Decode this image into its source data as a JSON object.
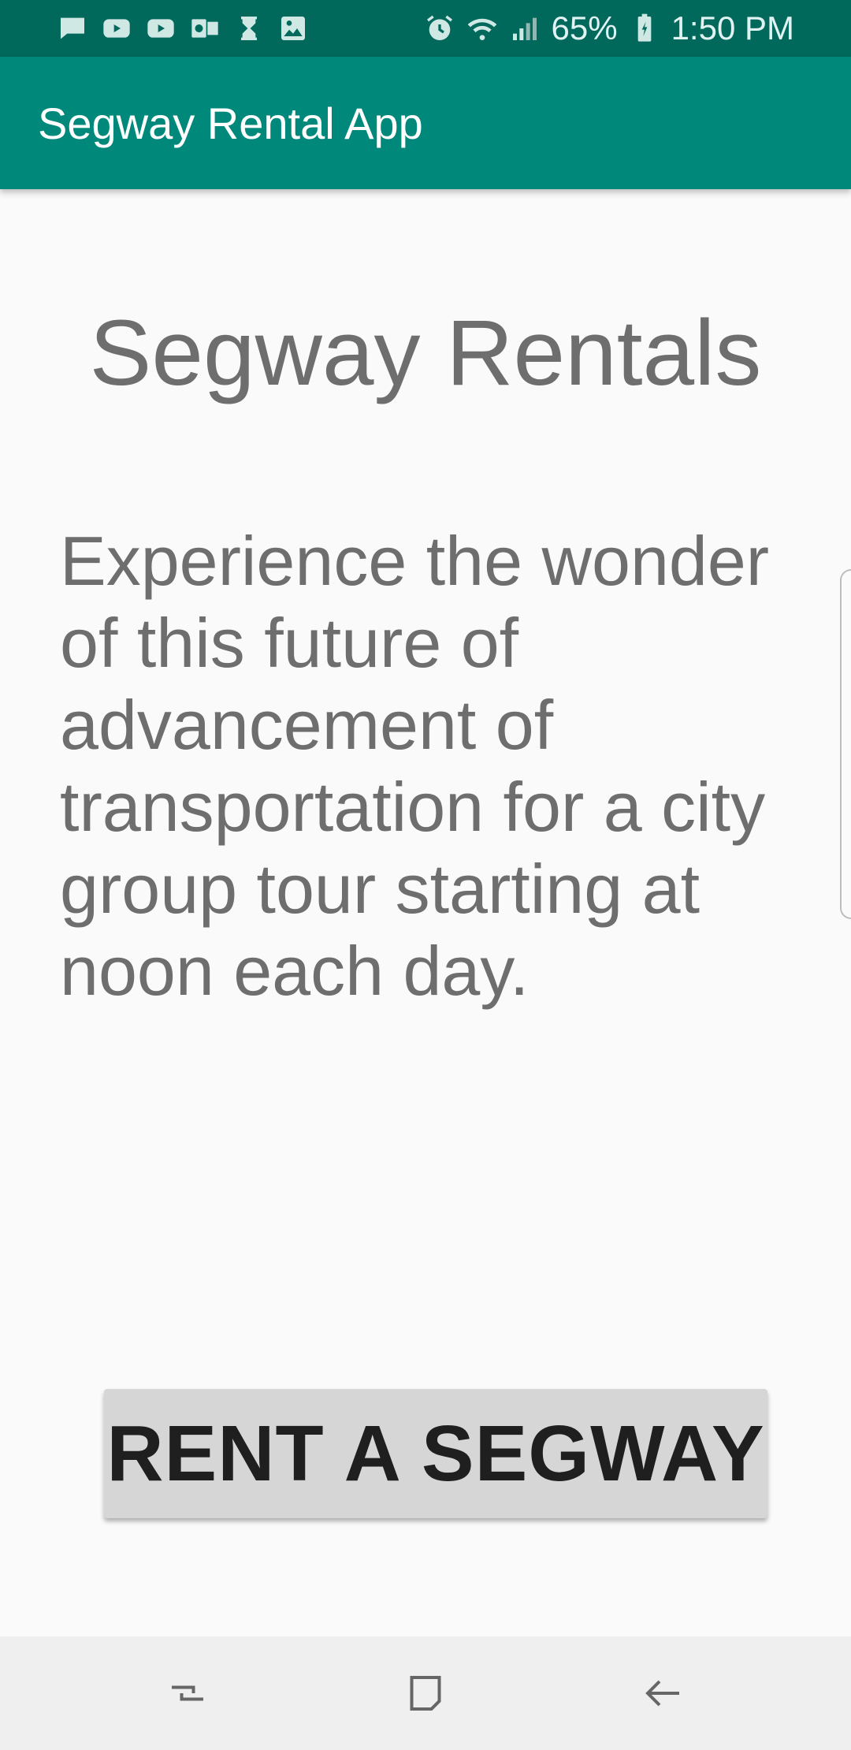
{
  "status_bar": {
    "notification_icons": [
      "message-icon",
      "youtube-icon",
      "youtube-icon",
      "outlook-icon",
      "hourglass-icon",
      "image-icon"
    ],
    "system_icons": [
      "alarm-icon",
      "wifi-icon",
      "signal-icon",
      "battery-icon"
    ],
    "battery_percent": "65%",
    "time": "1:50 PM"
  },
  "app_bar": {
    "title": "Segway Rental App"
  },
  "main": {
    "heading": "Segway Rentals",
    "description": "Experience the wonder of this future of advancement of transportation for a city group tour starting at noon each day.",
    "rent_button_label": "RENT A SEGWAY"
  },
  "nav_bar": {
    "icons": [
      "recents-icon",
      "home-icon",
      "back-icon"
    ]
  },
  "colors": {
    "status_bar": "#00695c",
    "app_bar": "#00897b",
    "background": "#fafafa",
    "text_gray": "#6e6e6e",
    "button_bg": "#d6d6d6"
  }
}
